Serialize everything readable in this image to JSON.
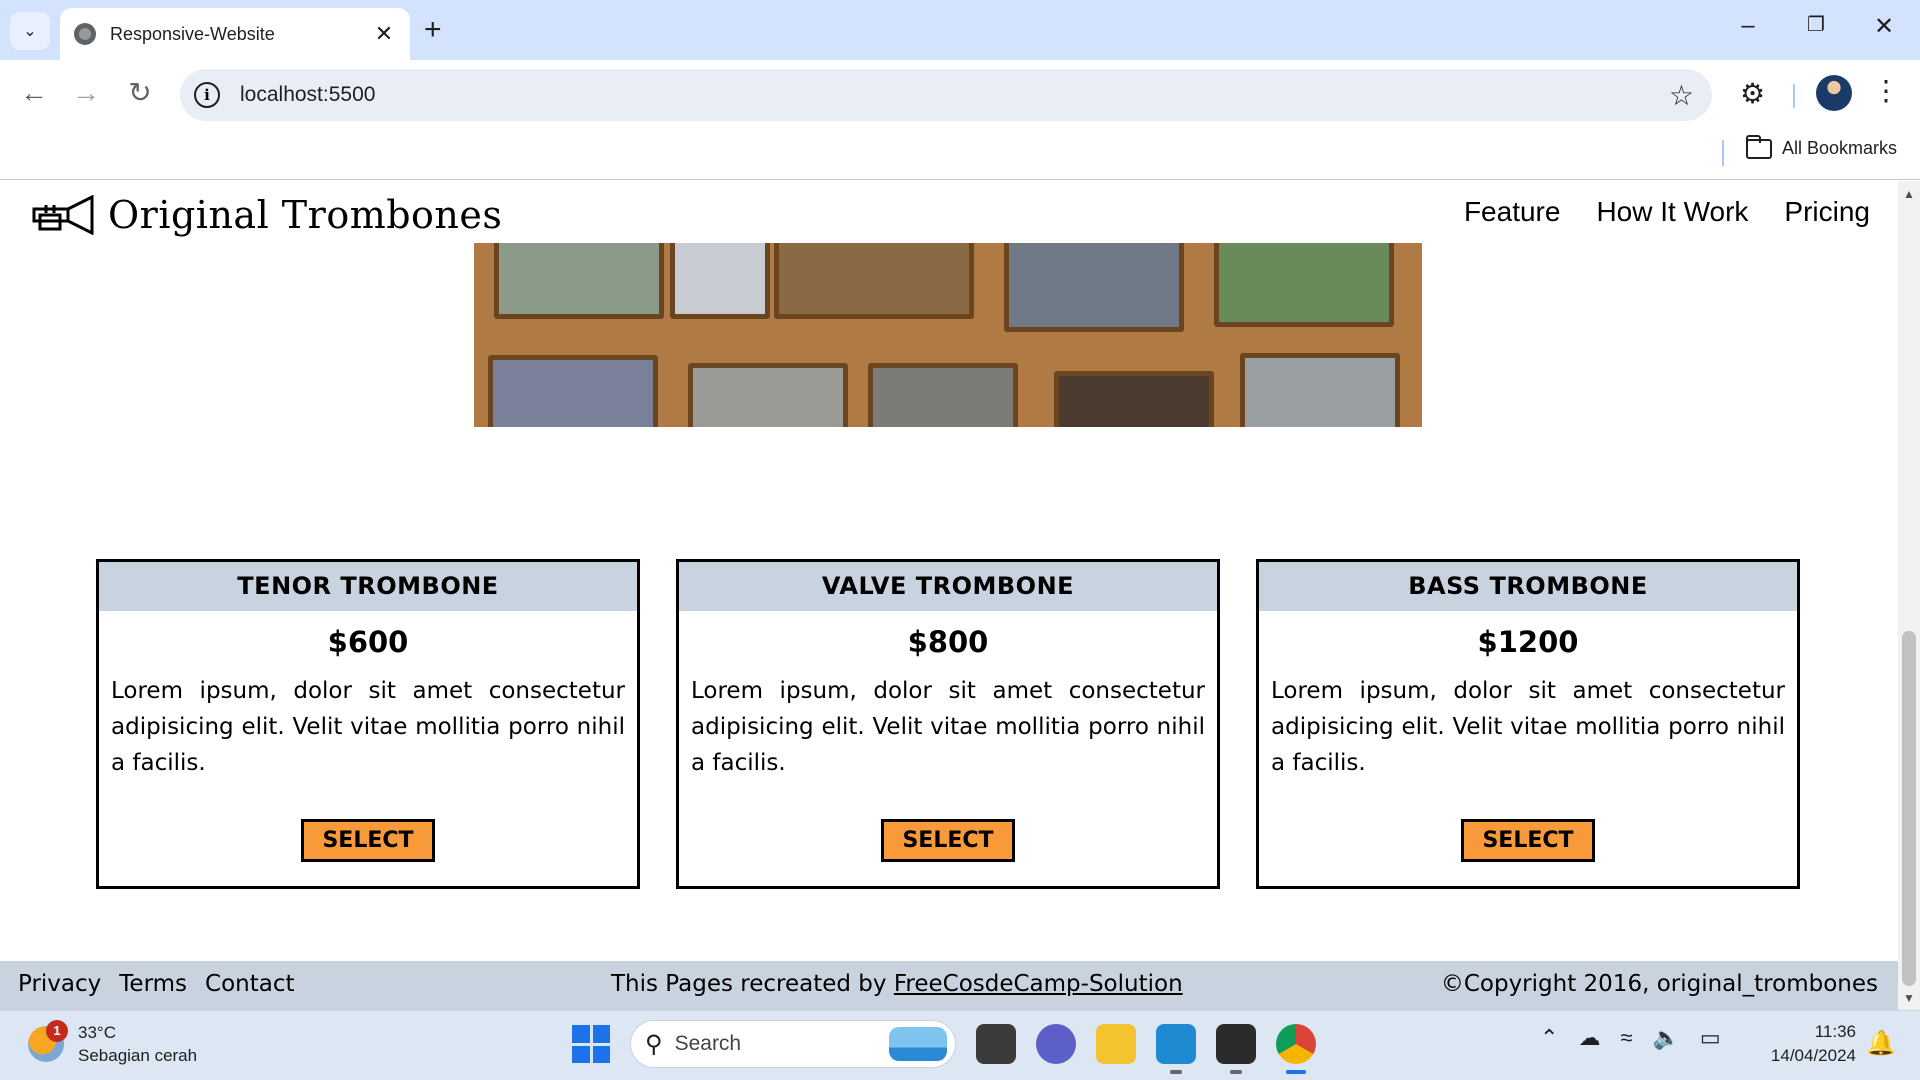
{
  "browser": {
    "tab_title": "Responsive-Website",
    "url": "localhost:5500",
    "bookmarks_label": "All Bookmarks"
  },
  "site": {
    "brand": "Original Trombones",
    "nav": [
      "Feature",
      "How It Work",
      "Pricing"
    ],
    "plans": [
      {
        "name": "TENOR TROMBONE",
        "price": "$600",
        "desc": "Lorem ipsum, dolor sit amet consectetur adipisicing elit. Velit vitae mollitia porro nihil a facilis.",
        "button": "SELECT"
      },
      {
        "name": "VALVE TROMBONE",
        "price": "$800",
        "desc": "Lorem ipsum, dolor sit amet consectetur adipisicing elit. Velit vitae mollitia porro nihil a facilis.",
        "button": "SELECT"
      },
      {
        "name": "BASS TROMBONE",
        "price": "$1200",
        "desc": "Lorem ipsum, dolor sit amet consectetur adipisicing elit. Velit vitae mollitia porro nihil a facilis.",
        "button": "SELECT"
      }
    ],
    "footer": {
      "links": [
        "Privacy",
        "Terms",
        "Contact"
      ],
      "credit_prefix": "This Pages recreated by ",
      "credit_link": "FreeCosdeCamp-Solution",
      "copyright": "©Copyright 2016, original_trombones"
    },
    "colors": {
      "card_header": "#c9d3e0",
      "button": "#f89a3a",
      "footer": "#c9d3e0"
    }
  },
  "taskbar": {
    "weather_temp": "33°C",
    "weather_desc": "Sebagian cerah",
    "weather_badge": "1",
    "search_label": "Search",
    "time": "11:36",
    "date": "14/04/2024"
  }
}
